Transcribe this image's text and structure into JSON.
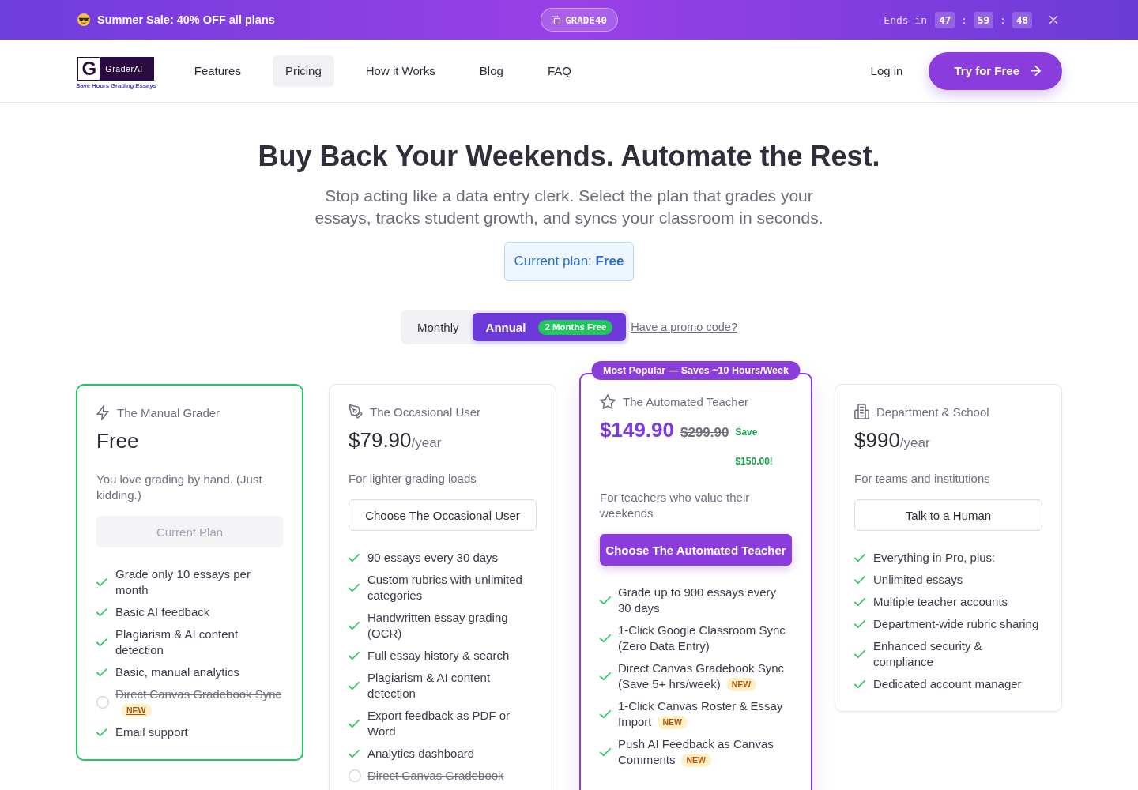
{
  "announcement": {
    "text": "Summer Sale: 40% OFF all plans",
    "promo_code": "GRADE40",
    "countdown": {
      "label": "Ends in",
      "parts": [
        {
          "kind": "value",
          "text": "47"
        },
        {
          "kind": "separator",
          "text": ":"
        },
        {
          "kind": "value",
          "text": "59"
        },
        {
          "kind": "separator",
          "text": ":"
        },
        {
          "kind": "value",
          "text": "48"
        }
      ]
    }
  },
  "header": {
    "logo": {
      "mark": "G",
      "name": "GraderAI",
      "tagline": "Save Hours Grading Essays"
    },
    "nav": [
      {
        "label": "Features",
        "selected": false
      },
      {
        "label": "Pricing",
        "selected": true
      },
      {
        "label": "How it Works",
        "selected": false
      },
      {
        "label": "Blog",
        "selected": false
      },
      {
        "label": "FAQ",
        "selected": false
      }
    ],
    "login": "Log in",
    "cta": "Try for Free"
  },
  "hero": {
    "title": "Buy Back Your Weekends. Automate the Rest.",
    "subtitle": "Stop acting like a data entry clerk. Select the plan that grades your essays, tracks student growth, and syncs your classroom in seconds.",
    "current_plan": "Current plan: **Free**"
  },
  "billing": {
    "options": [
      {
        "label": "Monthly",
        "selected": false
      },
      {
        "label": "Annual",
        "selected": true,
        "badge": "2 Months Free"
      }
    ],
    "promo_link": "Have a promo code?"
  },
  "plans": [
    {
      "name": "The Manual Grader",
      "price": "Free",
      "description": "You love grading by hand. (Just kidding.)",
      "button": {
        "label": "Current Plan",
        "kind": "disabled"
      },
      "current": true,
      "featured": false,
      "features": [
        {
          "text": "Grade only 10 essays per month",
          "included": true
        },
        {
          "text": "Basic AI feedback",
          "included": true
        },
        {
          "text": "Plagiarism & AI content detection",
          "included": true
        },
        {
          "text": "Basic, manual analytics",
          "included": true
        },
        {
          "text": "Direct Canvas Gradebook Sync",
          "included": false,
          "badge": "NEW"
        },
        {
          "text": "Email support",
          "included": true
        }
      ]
    },
    {
      "name": "The Occasional User",
      "price": "$79.90",
      "period": "/year",
      "description": "For lighter grading loads",
      "button": {
        "label": "Choose The Occasional User",
        "kind": "outline"
      },
      "current": false,
      "featured": false,
      "features": [
        {
          "text": "90 essays every 30 days",
          "included": true
        },
        {
          "text": "Custom rubrics with unlimited categories",
          "included": true
        },
        {
          "text": "Handwritten essay grading (OCR)",
          "included": true
        },
        {
          "text": "Full essay history & search",
          "included": true
        },
        {
          "text": "Plagiarism & AI content detection",
          "included": true
        },
        {
          "text": "Export feedback as PDF or Word",
          "included": true
        },
        {
          "text": "Analytics dashboard",
          "included": true
        },
        {
          "text": "Direct Canvas Gradebook",
          "included": false
        }
      ]
    },
    {
      "name": "The Automated Teacher",
      "badge": "Most Popular — Saves ~10 Hours/Week",
      "price": "$149.90",
      "original_price": "$299.90",
      "savings": "Save $150.00!",
      "description": "For teachers who value their weekends",
      "button": {
        "label": "Choose The Automated Teacher",
        "kind": "primary"
      },
      "current": false,
      "featured": true,
      "features": [
        {
          "text": "Grade up to 900 essays every 30 days",
          "included": true
        },
        {
          "text": "1-Click Google Classroom Sync (Zero Data Entry)",
          "included": true
        },
        {
          "text": "Direct Canvas Gradebook Sync (Save 5+ hrs/week)",
          "included": true,
          "badge": "NEW"
        },
        {
          "text": "1-Click Canvas Roster & Essay Import",
          "included": true,
          "badge": "NEW"
        },
        {
          "text": "Push AI Feedback as Canvas Comments",
          "included": true,
          "badge": "NEW"
        }
      ]
    },
    {
      "name": "Department & School",
      "price": "$990",
      "period": "/year",
      "description": "For teams and institutions",
      "button": {
        "label": "Talk to a Human",
        "kind": "outline"
      },
      "current": false,
      "featured": false,
      "features": [
        {
          "text": "Everything in Pro, plus:",
          "included": true
        },
        {
          "text": "Unlimited essays",
          "included": true
        },
        {
          "text": "Multiple teacher accounts",
          "included": true
        },
        {
          "text": "Department-wide rubric sharing",
          "included": true
        },
        {
          "text": "Enhanced security & compliance",
          "included": true
        },
        {
          "text": "Dedicated account manager",
          "included": true
        }
      ]
    }
  ]
}
